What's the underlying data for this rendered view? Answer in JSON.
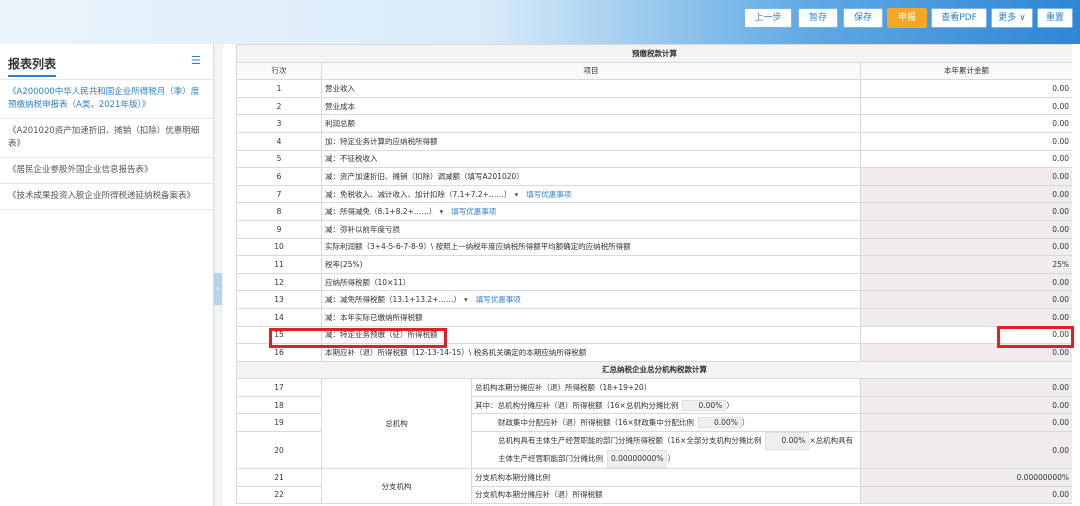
{
  "toolbar": {
    "buttons": {
      "prev": "上一步",
      "save_draft": "暂存",
      "save": "保存",
      "declare": "申报",
      "view_pdf": "查看PDF",
      "more": "更多",
      "reset": "重置"
    }
  },
  "sidebar": {
    "title": "报表列表",
    "items": [
      "《A200000中华人民共和国企业所得税月（季）度预缴纳税申报表（A类，2021年版）》",
      "《A201020资产加速折旧、摊销（扣除）优惠明细表》",
      "《居民企业参股外国企业信息报告表》",
      "《技术成果投资入股企业所得税递延纳税备案表》"
    ]
  },
  "table": {
    "section1": "预缴税款计算",
    "col_row": "行次",
    "col_item": "项目",
    "col_amount": "本年累计金额",
    "fill_link": "填写优惠事项",
    "rows": [
      {
        "no": "1",
        "item": "营业收入",
        "amount": "0.00"
      },
      {
        "no": "2",
        "item": "营业成本",
        "amount": "0.00"
      },
      {
        "no": "3",
        "item": "利润总额",
        "amount": "0.00"
      },
      {
        "no": "4",
        "item": "加：特定业务计算的应纳税所得额",
        "amount": "0.00"
      },
      {
        "no": "5",
        "item": "减：不征税收入",
        "amount": "0.00"
      },
      {
        "no": "6",
        "item": "减：资产加速折旧、摊销（扣除）调减额（填写A201020）",
        "amount": "0.00"
      },
      {
        "no": "7",
        "item": "减：免税收入、减计收入、加计扣除（7.1+7.2+……）",
        "amount": "0.00"
      },
      {
        "no": "8",
        "item": "减：所得减免（8.1+8.2+……）",
        "amount": "0.00"
      },
      {
        "no": "9",
        "item": "减：弥补以前年度亏损",
        "amount": "0.00"
      },
      {
        "no": "10",
        "item": "实际利润额（3+4-5-6-7-8-9）\\ 按照上一纳税年度应纳税所得额平均额确定的应纳税所得额",
        "amount": "0.00"
      },
      {
        "no": "11",
        "item": "税率(25%)",
        "amount": "25%"
      },
      {
        "no": "12",
        "item": "应纳所得税额（10×11）",
        "amount": "0.00"
      },
      {
        "no": "13",
        "item": "减：减免所得税额（13.1+13.2+……）",
        "amount": "0.00"
      },
      {
        "no": "14",
        "item": "减：本年实际已缴纳所得税额",
        "amount": "0.00"
      },
      {
        "no": "15",
        "item": "减：特定业务预缴（征）所得税额",
        "amount": "0.00"
      },
      {
        "no": "16",
        "item": "本期应补（退）所得税额（12-13-14-15）\\ 税务机关确定的本期应纳所得税额",
        "amount": "0.00"
      }
    ],
    "section2": "汇总纳税企业总分机构税款计算",
    "hq_label": "总机构",
    "branch_label": "分支机构",
    "rows2": [
      {
        "no": "17",
        "item": "总机构本期分摊应补（退）所得税额（18+19+20）",
        "amount": "0.00"
      },
      {
        "no": "18",
        "item": "其中：总机构分摊应补（退）所得税额（16×总机构分摊比例",
        "pct": "0.00%",
        "tail": "）",
        "amount": "0.00"
      },
      {
        "no": "19",
        "item": "财政集中分配应补（退）所得税额（16×财政集中分配比例",
        "pct": "0.00%",
        "tail": "）",
        "amount": "0.00"
      },
      {
        "no": "20",
        "item": "总机构具有主体生产经营职能的部门分摊所得税额（16×全部分支机构分摊比例",
        "pct": "0.00%",
        "mid": "×总机构具有主体生产经营职能部门分摊比例",
        "pct2": "0.00000000%",
        "tail": "）",
        "amount": "0.00"
      },
      {
        "no": "21",
        "item": "分支机构本期分摊比例",
        "amount": "0.00000000%"
      },
      {
        "no": "22",
        "item": "分支机构本期分摊应补（退）所得税额",
        "amount": "0.00"
      }
    ]
  }
}
